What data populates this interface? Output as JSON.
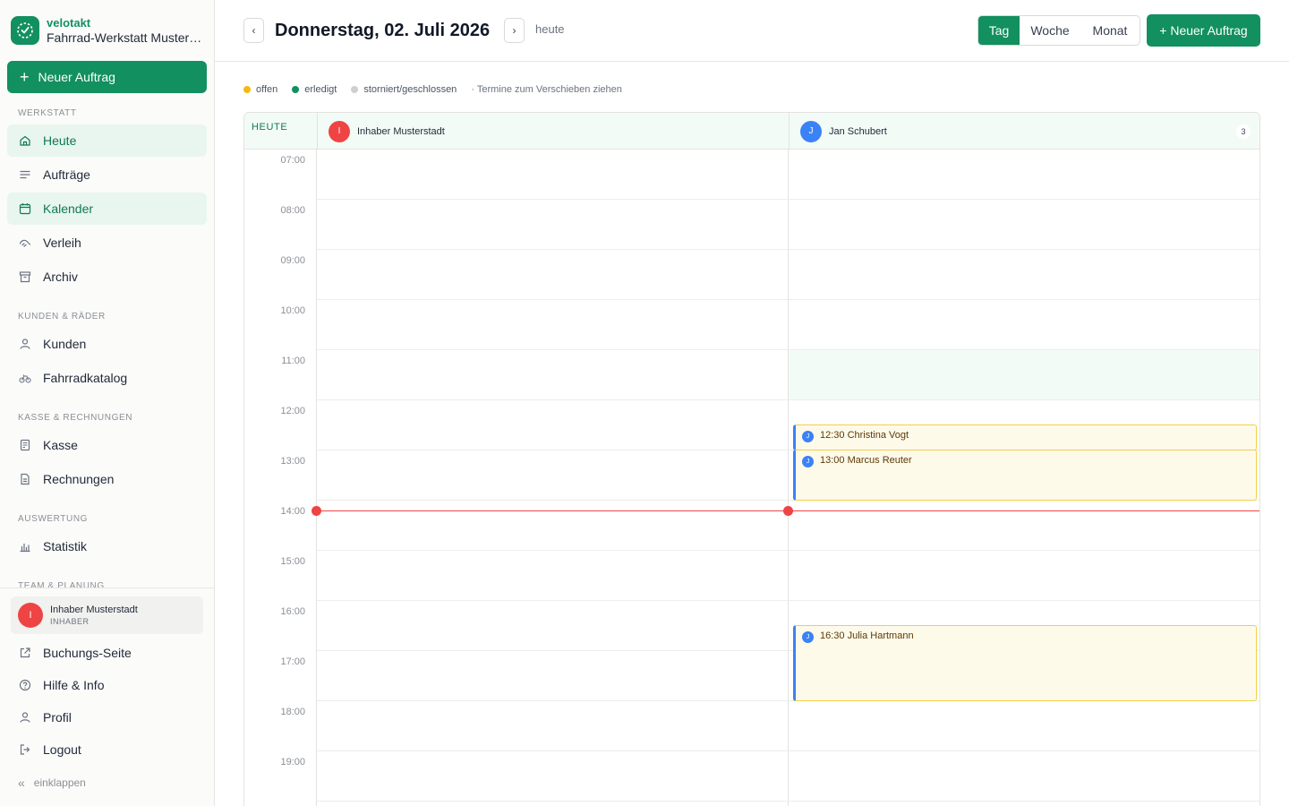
{
  "brand": {
    "name": "velotakt",
    "shop": "Fahrrad-Werkstatt Musterstadt"
  },
  "sidebar": {
    "new_order": "Neuer Auftrag",
    "sections": {
      "werkstatt": "WERKSTATT",
      "kunden": "KUNDEN & RÄDER",
      "kasse": "KASSE & RECHNUNGEN",
      "auswertung": "AUSWERTUNG",
      "team": "TEAM & PLANUNG"
    },
    "items": {
      "heute": "Heute",
      "auftraege": "Aufträge",
      "kalender": "Kalender",
      "verleih": "Verleih",
      "archiv": "Archiv",
      "kunden": "Kunden",
      "fahrradkatalog": "Fahrradkatalog",
      "kasse": "Kasse",
      "rechnungen": "Rechnungen",
      "statistik": "Statistik"
    },
    "user": {
      "initial": "I",
      "name": "Inhaber Musterstadt",
      "role": "INHABER"
    },
    "footer": {
      "buchung": "Buchungs-Seite",
      "hilfe": "Hilfe & Info",
      "profil": "Profil",
      "logout": "Logout",
      "collapse": "einklappen"
    }
  },
  "header": {
    "prev": "‹",
    "next": "›",
    "date_title": "Donnerstag, 02. Juli 2026",
    "today": "heute",
    "views": [
      "Tag",
      "Woche",
      "Monat"
    ],
    "active_view": "Tag",
    "new_order": "+ Neuer Auftrag"
  },
  "legend": {
    "open": "offen",
    "done": "erledigt",
    "cancelled": "storniert/geschlossen",
    "hint": "· Termine zum Verschieben ziehen"
  },
  "colors": {
    "brand": "#12905f",
    "open": "#f5b912",
    "done": "#12905f",
    "cancelled": "#cfcfcf",
    "now": "#ef4444",
    "staff_blue": "#3b82f6",
    "staff_red": "#ef4444"
  },
  "calendar": {
    "today_label": "HEUTE",
    "hours": [
      "07:00",
      "08:00",
      "09:00",
      "10:00",
      "11:00",
      "12:00",
      "13:00",
      "14:00",
      "15:00",
      "16:00",
      "17:00",
      "18:00",
      "19:00"
    ],
    "now_time": "14:12",
    "columns": [
      {
        "initial": "I",
        "name": "Inhaber Musterstadt",
        "count": ""
      },
      {
        "initial": "J",
        "name": "Jan Schubert",
        "count": "3"
      }
    ],
    "events": [
      {
        "staff_initial": "J",
        "label": "12:30 Christina Vogt",
        "start": "12:30",
        "end": "13:00"
      },
      {
        "staff_initial": "J",
        "label": "13:00 Marcus Reuter",
        "start": "13:00",
        "end": "14:00"
      },
      {
        "staff_initial": "J",
        "label": "16:30 Julia Hartmann",
        "start": "16:30",
        "end": "18:00"
      }
    ]
  }
}
